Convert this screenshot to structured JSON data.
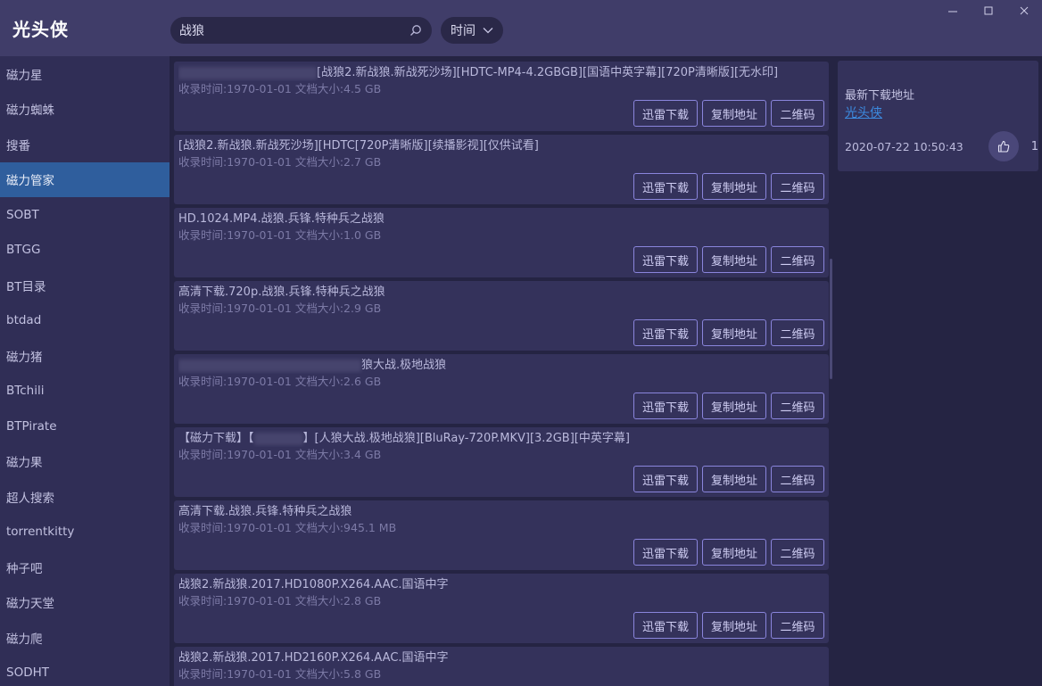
{
  "app": {
    "title": "光头侠"
  },
  "search": {
    "value": "战狼"
  },
  "sort": {
    "selected": "时间"
  },
  "sidebar": {
    "items": [
      {
        "label": "磁力星"
      },
      {
        "label": "磁力蜘蛛"
      },
      {
        "label": "搜番"
      },
      {
        "label": "磁力管家",
        "active": true
      },
      {
        "label": "SOBT"
      },
      {
        "label": "BTGG"
      },
      {
        "label": "BT目录"
      },
      {
        "label": "btdad"
      },
      {
        "label": "磁力猪"
      },
      {
        "label": "BTchili"
      },
      {
        "label": "BTPirate"
      },
      {
        "label": "磁力果"
      },
      {
        "label": "超人搜索"
      },
      {
        "label": "torrentkitty"
      },
      {
        "label": "种子吧"
      },
      {
        "label": "磁力天堂"
      },
      {
        "label": "磁力爬"
      },
      {
        "label": "SODHT"
      }
    ]
  },
  "buttons": {
    "thunder": "迅雷下载",
    "copy": "复制地址",
    "qrcode": "二维码"
  },
  "results": [
    {
      "title": "[战狼2.新战狼.新战死沙场][HDTC-MP4-4.2GBGB][国语中英字幕][720P清晰版][无水印]",
      "meta": "收录时间:1970-01-01 文档大小:4.5 GB"
    },
    {
      "title": "[战狼2.新战狼.新战死沙场][HDTC[720P清晰版][续播影视][仅供试看]",
      "meta": "收录时间:1970-01-01 文档大小:2.7 GB"
    },
    {
      "title": "HD.1024.MP4.战狼.兵锋.特种兵之战狼",
      "meta": "收录时间:1970-01-01 文档大小:1.0 GB"
    },
    {
      "title": "高清下载.720p.战狼.兵锋.特种兵之战狼",
      "meta": "收录时间:1970-01-01 文档大小:2.9 GB"
    },
    {
      "title": "狼大战.极地战狼",
      "meta": "收录时间:1970-01-01 文档大小:2.6 GB"
    },
    {
      "title_prefix": "【磁力下载】【",
      "title": "】[人狼大战.极地战狼][BluRay-720P.MKV][3.2GB][中英字幕]",
      "meta": "收录时间:1970-01-01 文档大小:3.4 GB"
    },
    {
      "title": "高清下载.战狼.兵锋.特种兵之战狼",
      "meta": "收录时间:1970-01-01 文档大小:945.1 MB"
    },
    {
      "title": "战狼2.新战狼.2017.HD1080P.X264.AAC.国语中字",
      "meta": "收录时间:1970-01-01 文档大小:2.8 GB"
    },
    {
      "title": "战狼2.新战狼.2017.HD2160P.X264.AAC.国语中字",
      "meta": "收录时间:1970-01-01 文档大小:5.8 GB"
    }
  ],
  "panel": {
    "title": "最新下载地址",
    "link": "光头侠",
    "date": "2020-07-22 10:50:43",
    "likes": "1"
  },
  "colors": {
    "titlebar": "#403d69",
    "sidebar": "#302e56",
    "active": "#2f5e9d",
    "card": "#34325b",
    "accent": "#8a85dc",
    "link": "#3c8be0"
  }
}
